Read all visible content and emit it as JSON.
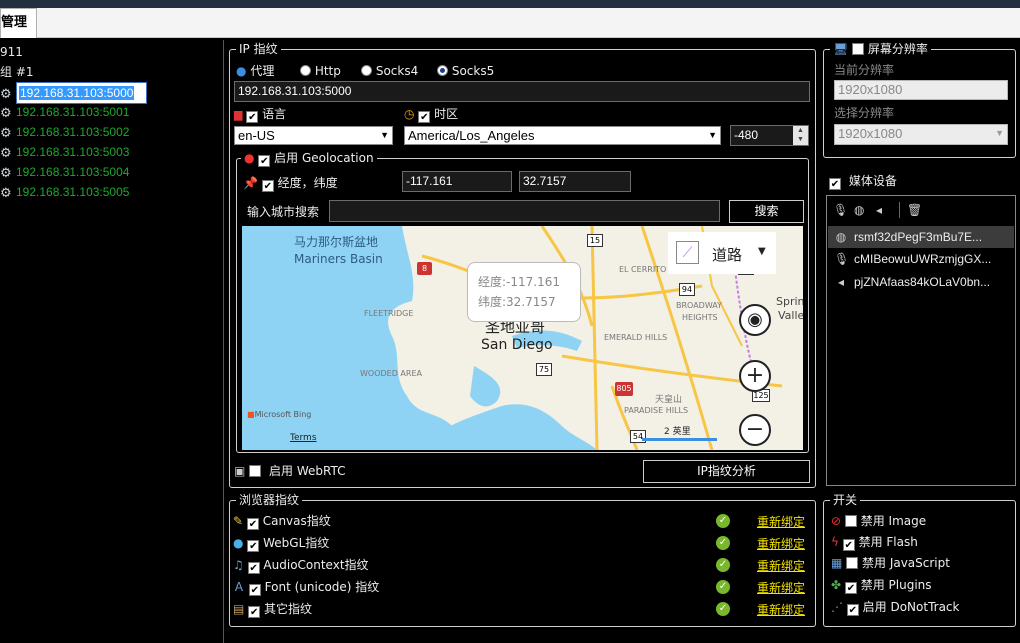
{
  "tab": {
    "label": "管理"
  },
  "tree": {
    "root": "911",
    "group": "组 #1",
    "items": [
      "192.168.31.103:5000",
      "192.168.31.103:5001",
      "192.168.31.103:5002",
      "192.168.31.103:5003",
      "192.168.31.103:5004",
      "192.168.31.103:5005"
    ]
  },
  "ip": {
    "legend": "IP 指纹",
    "proxy_label": "代理",
    "options": [
      "Http",
      "Socks4",
      "Socks5"
    ],
    "selected": "Socks5",
    "proxy_value": "192.168.31.103:5000",
    "language_label": "语言",
    "language_value": "en-US",
    "timezone_label": "时区",
    "timezone_value": "America/Los_Angeles",
    "offset_value": "-480",
    "geo_label": "启用 Geolocation",
    "coord_label": "经度，纬度",
    "lon": "-117.161",
    "lat": "32.7157",
    "search_label": "输入城市搜索",
    "search_placeholder": "",
    "search_button": "搜索",
    "webrtc_label": "启用 WebRTC",
    "analyze_button": "IP指纹分析"
  },
  "map": {
    "basin_cn": "马力那尔斯盆地",
    "basin_en": "Mariners Basin",
    "fleetridge": "FLEETRIDGE",
    "wooded": "WOODED AREA",
    "elcerrito": "EL CERRITO",
    "broadway": "BROADWAY",
    "heights": "HEIGHTS",
    "emerald": "EMERALD HILLS",
    "tianhuang": "天皇山",
    "paradise": "PARADISE HILLS",
    "spring": "Sprin",
    "valley": "Valle",
    "city_cn": "圣地亚哥",
    "city_en": "San Diego",
    "popup_lon": "经度:-117.161",
    "popup_lat": "纬度:32.7157",
    "road_label": "道路",
    "bing": "Microsoft Bing",
    "terms": "Terms",
    "scale": "2 英里",
    "shields": [
      "15",
      "8",
      "94",
      "805",
      "75",
      "94",
      "125",
      "54"
    ]
  },
  "screen": {
    "legend": "屏幕分辨率",
    "current_label": "当前分辨率",
    "current_value": "1920x1080",
    "select_label": "选择分辨率",
    "select_value": "1920x1080"
  },
  "media": {
    "label": "媒体设备",
    "items": [
      "rsmf32dPegF3mBu7E...",
      "cMIBeowuUWRzmjgGX...",
      "pjZNAfaas84kOLaV0bn..."
    ]
  },
  "browser": {
    "legend": "浏览器指纹",
    "rows": [
      "Canvas指纹",
      "WebGL指纹",
      "AudioContext指纹",
      "Font (unicode) 指纹",
      "其它指纹"
    ],
    "relink": "重新绑定"
  },
  "switch": {
    "legend": "开关",
    "rows": [
      "禁用 Image",
      "禁用 Flash",
      "禁用 JavaScript",
      "禁用 Plugins",
      "启用 DoNotTrack"
    ]
  }
}
